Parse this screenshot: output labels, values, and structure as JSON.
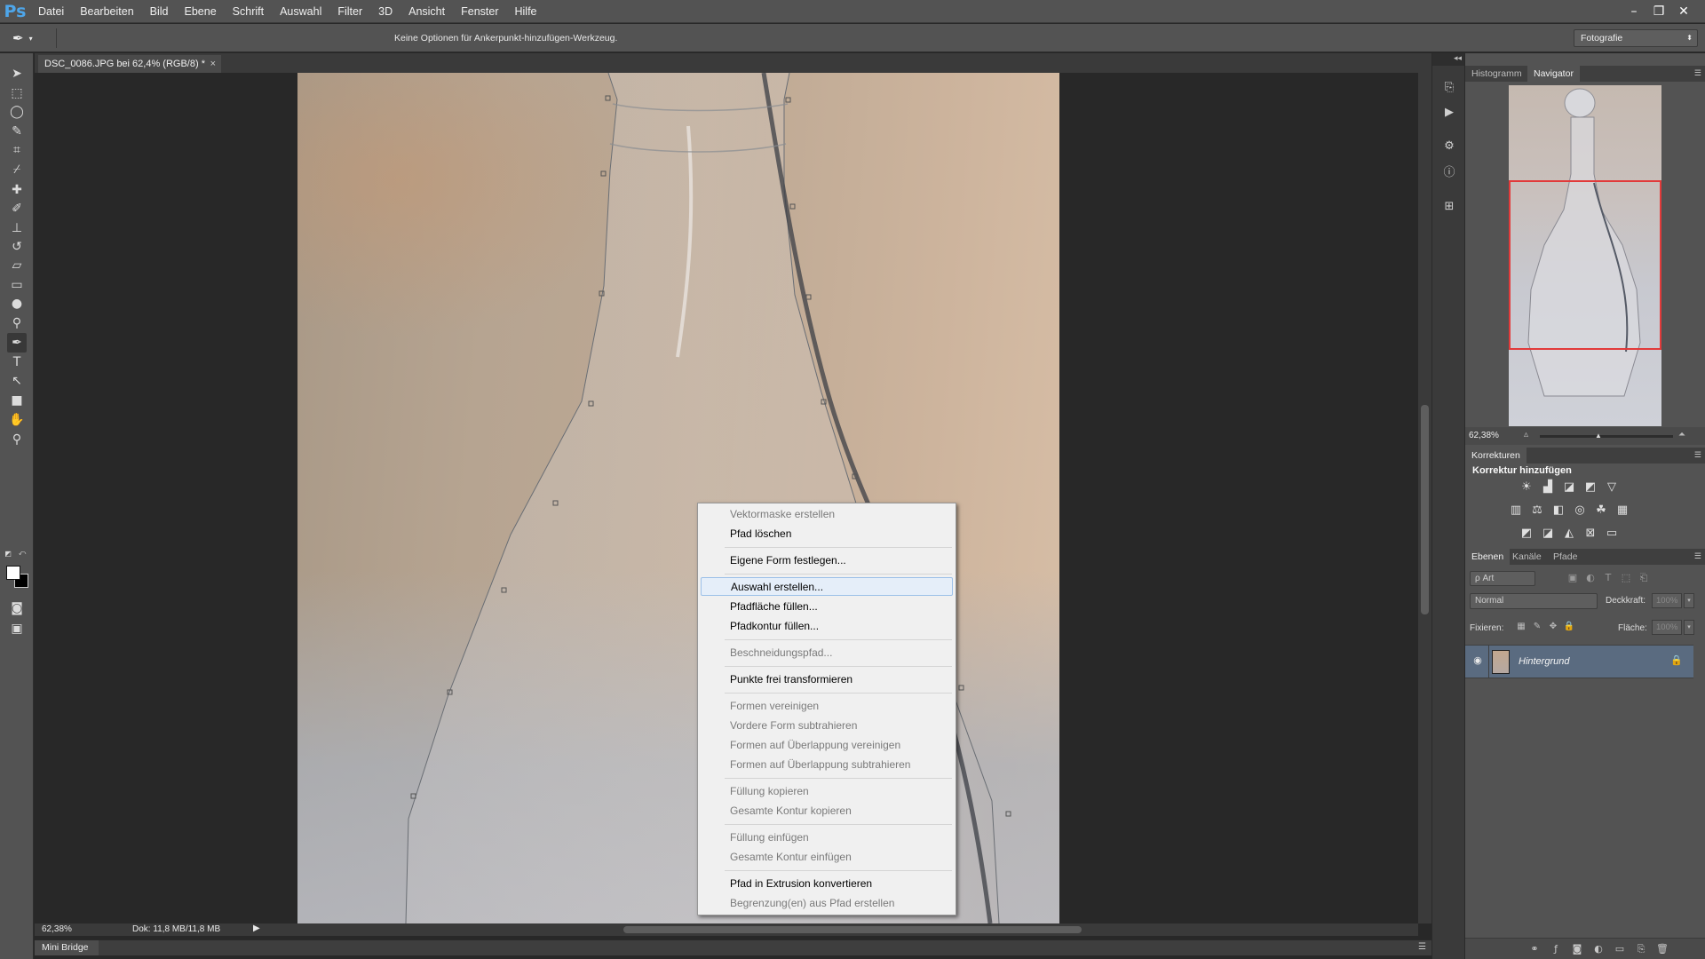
{
  "app": {
    "logo": "Ps"
  },
  "menubar": {
    "items": [
      "Datei",
      "Bearbeiten",
      "Bild",
      "Ebene",
      "Schrift",
      "Auswahl",
      "Filter",
      "3D",
      "Ansicht",
      "Fenster",
      "Hilfe"
    ],
    "window_controls": {
      "minimize": "–",
      "restore": "❐",
      "close": "✕"
    }
  },
  "optionsbar": {
    "tool_icon": "pen-add-anchor-icon",
    "message": "Keine Optionen für Ankerpunkt-hinzufügen-Werkzeug.",
    "workspace": "Fotografie"
  },
  "document": {
    "tab_title": "DSC_0086.JPG bei 62,4% (RGB/8) *",
    "close": "×"
  },
  "statusbar": {
    "zoom": "62,38%",
    "doc_size": "Dok: 11,8 MB/11,8 MB"
  },
  "minibridge": {
    "label": "Mini Bridge"
  },
  "context_menu": {
    "items": [
      {
        "label": "Vektormaske erstellen",
        "enabled": false
      },
      {
        "label": "Pfad löschen",
        "enabled": true
      },
      {
        "label": "Eigene Form festlegen...",
        "enabled": true
      },
      {
        "label": "Auswahl erstellen...",
        "enabled": true,
        "hovered": true
      },
      {
        "label": "Pfadfläche füllen...",
        "enabled": true
      },
      {
        "label": "Pfadkontur füllen...",
        "enabled": true
      },
      {
        "label": "Beschneidungspfad...",
        "enabled": false
      },
      {
        "label": "Punkte frei transformieren",
        "enabled": true
      },
      {
        "label": "Formen vereinigen",
        "enabled": false
      },
      {
        "label": "Vordere Form subtrahieren",
        "enabled": false
      },
      {
        "label": "Formen auf Überlappung vereinigen",
        "enabled": false
      },
      {
        "label": "Formen auf Überlappung subtrahieren",
        "enabled": false
      },
      {
        "label": "Füllung kopieren",
        "enabled": false
      },
      {
        "label": "Gesamte Kontur kopieren",
        "enabled": false
      },
      {
        "label": "Füllung einfügen",
        "enabled": false
      },
      {
        "label": "Gesamte Kontur einfügen",
        "enabled": false
      },
      {
        "label": "Pfad in Extrusion konvertieren",
        "enabled": true
      },
      {
        "label": "Begrenzung(en) aus Pfad erstellen",
        "enabled": false
      }
    ]
  },
  "navigator_panel": {
    "tabs": [
      "Histogramm",
      "Navigator"
    ],
    "active_tab": "Navigator",
    "zoom": "62,38%"
  },
  "adjustments_panel": {
    "tab": "Korrekturen",
    "title": "Korrektur hinzufügen"
  },
  "layers_panel": {
    "tabs": [
      "Ebenen",
      "Kanäle",
      "Pfade"
    ],
    "active_tab": "Ebenen",
    "kind_filter": "ρ Art",
    "blend_mode": "Normal",
    "opacity_label": "Deckkraft:",
    "opacity_value": "100%",
    "lock_label": "Fixieren:",
    "fill_label": "Fläche:",
    "fill_value": "100%",
    "layers": [
      {
        "name": "Hintergrund",
        "visible": true,
        "locked": true
      }
    ]
  },
  "colors": {
    "foreground": "#ffffff",
    "background": "#000000",
    "navigator_proxy": "#e23a3a",
    "selected_layer": "#5a6b80",
    "ps_blue": "#4ea6ea"
  }
}
